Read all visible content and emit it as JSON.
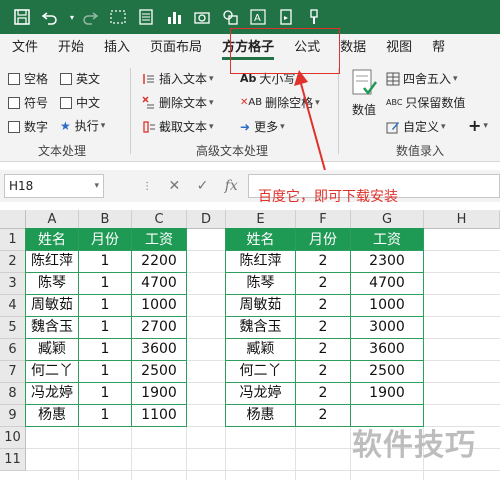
{
  "colors": {
    "green": "#217346",
    "table_header": "#1f9a55",
    "annotation": "#e0312c"
  },
  "qat": {
    "icons": [
      "save-icon",
      "undo-icon",
      "redo-icon",
      "selection-icon",
      "form-icon",
      "chart-icon",
      "camera-icon",
      "shape-icon",
      "text-box-icon",
      "macro-icon",
      "brush-icon"
    ]
  },
  "tabs": [
    "文件",
    "开始",
    "插入",
    "页面布局",
    "方方格子",
    "公式",
    "数据",
    "视图",
    "帮"
  ],
  "ribbon": {
    "checkboxes": [
      "空格",
      "英文",
      "符号",
      "中文",
      "数字"
    ],
    "execute": "执行",
    "insert_text": "插入文本",
    "delete_text": "删除文本",
    "cut_text": "截取文本",
    "case": "大小写",
    "delete_space": "删除空格",
    "more": "更多",
    "number": "数值",
    "round": "四舍五入",
    "keep_numbers": "只保留数值",
    "custom": "自定义",
    "group_text": "文本处理",
    "group_advanced": "高级文本处理",
    "group_number": "数值录入"
  },
  "formula_bar": {
    "cell_ref": "H18",
    "fx": "fx"
  },
  "annotation": "百度它，即可下载安装",
  "columns": [
    "A",
    "B",
    "C",
    "D",
    "E",
    "F",
    "G",
    "H"
  ],
  "rows": [
    "1",
    "2",
    "3",
    "4",
    "5",
    "6",
    "7",
    "8",
    "9",
    "10",
    "11"
  ],
  "table1": {
    "headers": [
      "姓名",
      "月份",
      "工资"
    ],
    "rows": [
      [
        "陈红萍",
        "1",
        "2200"
      ],
      [
        "陈琴",
        "1",
        "4700"
      ],
      [
        "周敏茹",
        "1",
        "1000"
      ],
      [
        "魏含玉",
        "1",
        "2700"
      ],
      [
        "臧颖",
        "1",
        "3600"
      ],
      [
        "何二丫",
        "1",
        "2500"
      ],
      [
        "冯龙婷",
        "1",
        "1900"
      ],
      [
        "杨惠",
        "1",
        "1100"
      ]
    ]
  },
  "table2": {
    "headers": [
      "姓名",
      "月份",
      "工资"
    ],
    "rows": [
      [
        "陈红萍",
        "2",
        "2300"
      ],
      [
        "陈琴",
        "2",
        "4700"
      ],
      [
        "周敏茹",
        "2",
        "1000"
      ],
      [
        "魏含玉",
        "2",
        "3000"
      ],
      [
        "臧颖",
        "2",
        "3600"
      ],
      [
        "何二丫",
        "2",
        "2500"
      ],
      [
        "冯龙婷",
        "2",
        "1900"
      ],
      [
        "杨惠",
        "2",
        ""
      ]
    ]
  },
  "watermark": "软件技巧"
}
